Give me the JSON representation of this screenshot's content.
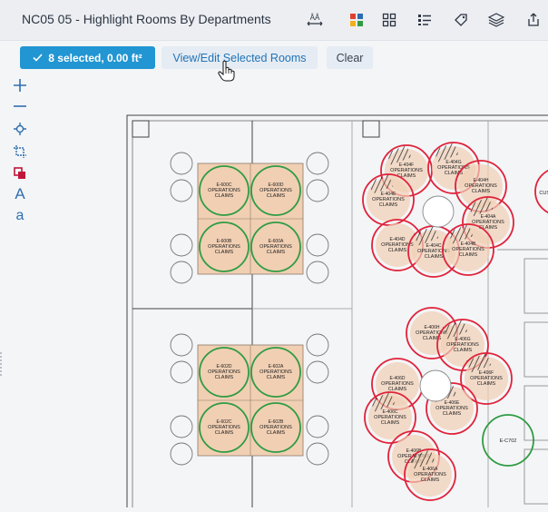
{
  "header": {
    "title": "NC05 05 - Highlight Rooms By Departments",
    "icons": [
      "distance-icon",
      "color-grid-icon",
      "grid-outline-icon",
      "list-icon",
      "tag-icon",
      "layers-icon",
      "share-icon"
    ]
  },
  "selection": {
    "summary": "8 selected, 0.00 ft²",
    "view_edit_label": "View/Edit Selected Rooms",
    "clear_label": "Clear",
    "accent": "#2196d3"
  },
  "tools": {
    "text_a_upper": "A",
    "text_a_lower": "a"
  },
  "plan": {
    "colors": {
      "room_fill": "#f1cfb3",
      "green_ring": "#2f9c44",
      "red_ring": "#e0223a"
    },
    "rooms": [
      {
        "id": "E-600C",
        "dept1": "OPERATIONS",
        "dept2": "CLAIMS",
        "ring": "green"
      },
      {
        "id": "E-600D",
        "dept1": "OPERATIONS",
        "dept2": "CLAIMS",
        "ring": "green"
      },
      {
        "id": "E-600B",
        "dept1": "OPERATIONS",
        "dept2": "CLAIMS",
        "ring": "green"
      },
      {
        "id": "E-600A",
        "dept1": "OPERATIONS",
        "dept2": "CLAIMS",
        "ring": "green"
      },
      {
        "id": "E-602D",
        "dept1": "OPERATIONS",
        "dept2": "CLAIMS",
        "ring": "green"
      },
      {
        "id": "E-602A",
        "dept1": "OPERATIONS",
        "dept2": "CLAIMS",
        "ring": "green"
      },
      {
        "id": "E-602C",
        "dept1": "OPERATIONS",
        "dept2": "CLAIMS",
        "ring": "green"
      },
      {
        "id": "E-602B",
        "dept1": "OPERATIONS",
        "dept2": "CLAIMS",
        "ring": "green"
      },
      {
        "id": "E-404F",
        "dept1": "OPERATIONS",
        "dept2": "CLAIMS",
        "ring": "red"
      },
      {
        "id": "E-404G",
        "dept1": "OPERATIONS",
        "dept2": "CLAIMS",
        "ring": "red"
      },
      {
        "id": "E-404H",
        "dept1": "OPERATIONS",
        "dept2": "CLAIMS",
        "ring": "red"
      },
      {
        "id": "E-404E",
        "dept1": "OPERATIONS",
        "dept2": "CLAIMS",
        "ring": "red"
      },
      {
        "id": "E-404A",
        "dept1": "OPERATIONS",
        "dept2": "CLAIMS",
        "ring": "red"
      },
      {
        "id": "E-404D",
        "dept1": "OPERATIONS",
        "dept2": "CLAIMS",
        "ring": "red"
      },
      {
        "id": "E-404C",
        "dept1": "OPERATIONS",
        "dept2": "CLAIMS",
        "ring": "red"
      },
      {
        "id": "E-404B",
        "dept1": "OPERATIONS",
        "dept2": "CLAIMS",
        "ring": "red"
      },
      {
        "id": "E-406H",
        "dept1": "OPERATIONS",
        "dept2": "CLAIMS",
        "ring": "red"
      },
      {
        "id": "E-406G",
        "dept1": "OPERATIONS",
        "dept2": "CLAIMS",
        "ring": "red"
      },
      {
        "id": "E-406F",
        "dept1": "OPERATIONS",
        "dept2": "CLAIMS",
        "ring": "red"
      },
      {
        "id": "E-406D",
        "dept1": "OPERATIONS",
        "dept2": "CLAIMS",
        "ring": "red"
      },
      {
        "id": "E-406E",
        "dept1": "OPERATIONS",
        "dept2": "CLAIMS",
        "ring": "red"
      },
      {
        "id": "E-406C",
        "dept1": "OPERATIONS",
        "dept2": "CLAIMS",
        "ring": "red"
      },
      {
        "id": "E-406B",
        "dept1": "OPERATIONS",
        "dept2": "CLAIMS",
        "ring": "red"
      },
      {
        "id": "E-406A",
        "dept1": "OPERATIONS",
        "dept2": "CLAIMS",
        "ring": "red"
      }
    ],
    "extra_room": {
      "id": "E-C702"
    },
    "edge_room": {
      "line1": "O",
      "line2": "CUSTO"
    }
  }
}
